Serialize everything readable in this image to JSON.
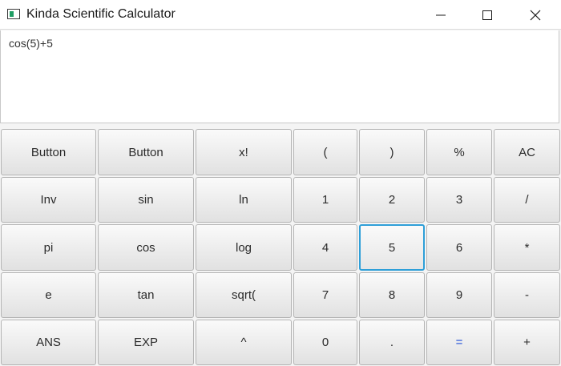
{
  "window": {
    "title": "Kinda Scientific Calculator",
    "controls": [
      "minimize-icon",
      "maximize-icon",
      "close-icon"
    ]
  },
  "display": {
    "expression": "cos(5)+5"
  },
  "keys": [
    [
      "Button",
      "Button",
      "x!",
      "(",
      ")",
      "%",
      "AC"
    ],
    [
      "Inv",
      "sin",
      "ln",
      "1",
      "2",
      "3",
      "/"
    ],
    [
      "pi",
      "cos",
      "log",
      "4",
      "5",
      "6",
      "*"
    ],
    [
      "e",
      "tan",
      "sqrt(",
      "7",
      "8",
      "9",
      "-"
    ],
    [
      "ANS",
      "EXP",
      "^",
      "0",
      ".",
      "=",
      "+"
    ]
  ],
  "focused_key": "5",
  "colors": {
    "focus_ring": "#2e9fd8",
    "equals_text": "#1f4fd8",
    "icon_green": "#1f9e64"
  }
}
